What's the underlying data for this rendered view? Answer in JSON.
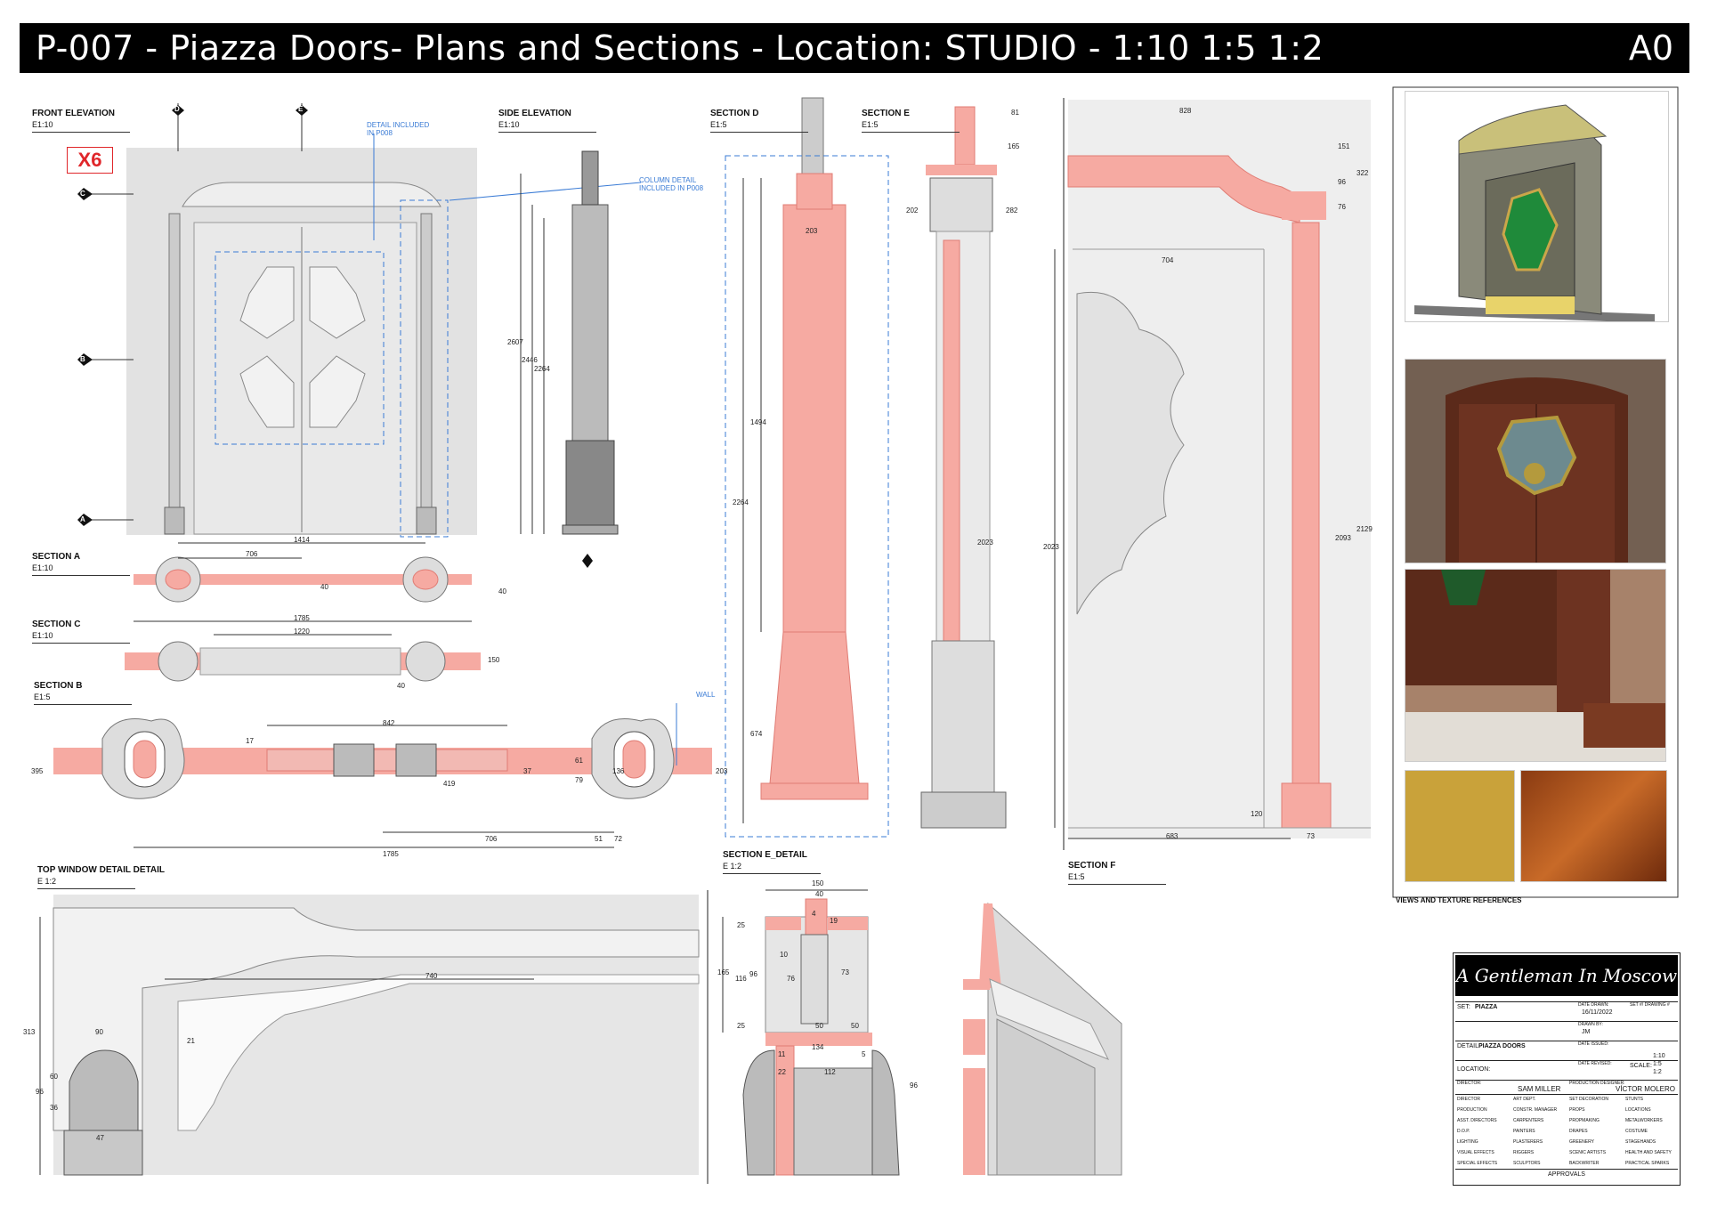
{
  "header": {
    "title": "P-007 - Piazza Doors- Plans and Sections - Location: STUDIO - 1:10  1:5  1:2",
    "sheet_size": "A0"
  },
  "labels": {
    "front_elevation": "FRONT ELEVATION",
    "front_scale": "E1:10",
    "side_elevation": "SIDE ELEVATION",
    "side_scale": "E1:10",
    "section_d": "SECTION D",
    "section_d_scale": "E1:5",
    "section_e": "SECTION E",
    "section_e_scale": "E1:5",
    "section_a": "SECTION A",
    "section_a_scale": "E1:10",
    "section_c": "SECTION C",
    "section_c_scale": "E1:10",
    "section_b": "SECTION B",
    "section_b_scale": "E1:5",
    "top_window": "TOP WINDOW DETAIL DETAIL",
    "top_window_scale": "E 1:2",
    "section_e_detail": "SECTION E_DETAIL",
    "section_e_detail_scale": "E 1:2",
    "section_f": "SECTION F",
    "section_f_scale": "E1:5",
    "views": "VIEWS AND TEXTURE REFERENCES"
  },
  "notes": {
    "x6": "X6",
    "detail_p008": "DETAIL INCLUDED IN P008",
    "column_detail": "COLUMN DETAIL INCLUDED IN P008",
    "wall": "WALL"
  },
  "markers": {
    "d": "D",
    "e": "E",
    "c": "C",
    "b": "B",
    "a": "A"
  },
  "dimensions": {
    "front": [
      "1414",
      "706",
      "40",
      "40"
    ],
    "section_c": [
      "1785",
      "1220",
      "150",
      "40"
    ],
    "section_b": [
      "842",
      "17",
      "37",
      "419",
      "61",
      "79",
      "136",
      "203",
      "706",
      "51",
      "72",
      "1785",
      "395"
    ],
    "side": [
      "2607",
      "2446",
      "2264"
    ],
    "section_d": [
      "203",
      "1494",
      "2264",
      "674"
    ],
    "section_e": [
      "81",
      "165",
      "202",
      "282",
      "2023"
    ],
    "section_f": [
      "828",
      "151",
      "322",
      "96",
      "76",
      "704",
      "2023",
      "2093",
      "2129",
      "120",
      "683",
      "73"
    ],
    "top_window": [
      "740",
      "90",
      "313",
      "96",
      "60",
      "36",
      "47",
      "21"
    ],
    "detail_e": [
      "150",
      "40",
      "4",
      "19",
      "25",
      "165",
      "96",
      "116",
      "10",
      "76",
      "73",
      "25",
      "50",
      "50",
      "134",
      "11",
      "5",
      "22",
      "112",
      "96"
    ]
  },
  "title_block": {
    "production": "A Gentleman In Moscow",
    "set_label": "SET:",
    "set": "PIAZZA",
    "date_drawn_label": "DATE DRAWN:",
    "date_drawn": "16/11/2022",
    "drawn_by_label": "DRAWN BY:",
    "drawn_by": "JM",
    "set_drawing_label": "SET #/ DRAWING #",
    "detail_label": "DETAIL:",
    "detail": "PIAZZA DOORS",
    "date_issued_label": "DATE ISSUED:",
    "date_revised_label": "DATE REVISED:",
    "location_label": "LOCATION:",
    "scale_label": "SCALE:",
    "scales": "1:10\n1:5\n1:2",
    "director_label": "DIRECTOR:",
    "director": "SAM MILLER",
    "designer_label": "PRODUCTION DESIGNER:",
    "designer": "VÍCTOR MOLERO",
    "approvals": "APPROVALS",
    "roles": [
      [
        "DIRECTOR",
        "ART DEPT.",
        "SET DECORATION",
        "STUNTS"
      ],
      [
        "PRODUCTION",
        "CONSTR. MANAGER",
        "PROPS",
        "LOCATIONS"
      ],
      [
        "ASST. DIRECTORS",
        "CARPENTERS",
        "PROPMAKING",
        "METALWORKERS"
      ],
      [
        "D.O.P.",
        "PAINTERS",
        "DRAPES",
        "COSTUME"
      ],
      [
        "LIGHTING",
        "PLASTERERS",
        "GREENERY",
        "STAGEHANDS"
      ],
      [
        "VISUAL EFFECTS",
        "RIGGERS",
        "SCENIC ARTISTS",
        "HEALTH AND SAFETY"
      ],
      [
        "SPECIAL EFFECTS",
        "SCULPTORS",
        "BACKWRITER",
        "PRACTICAL SPARKS"
      ]
    ]
  },
  "colors": {
    "section_fill": "#f6aaa2",
    "section_stroke": "#e07c74",
    "grey": "#dcdcdc",
    "blue": "#3a7bd5",
    "red": "#e0262a"
  }
}
